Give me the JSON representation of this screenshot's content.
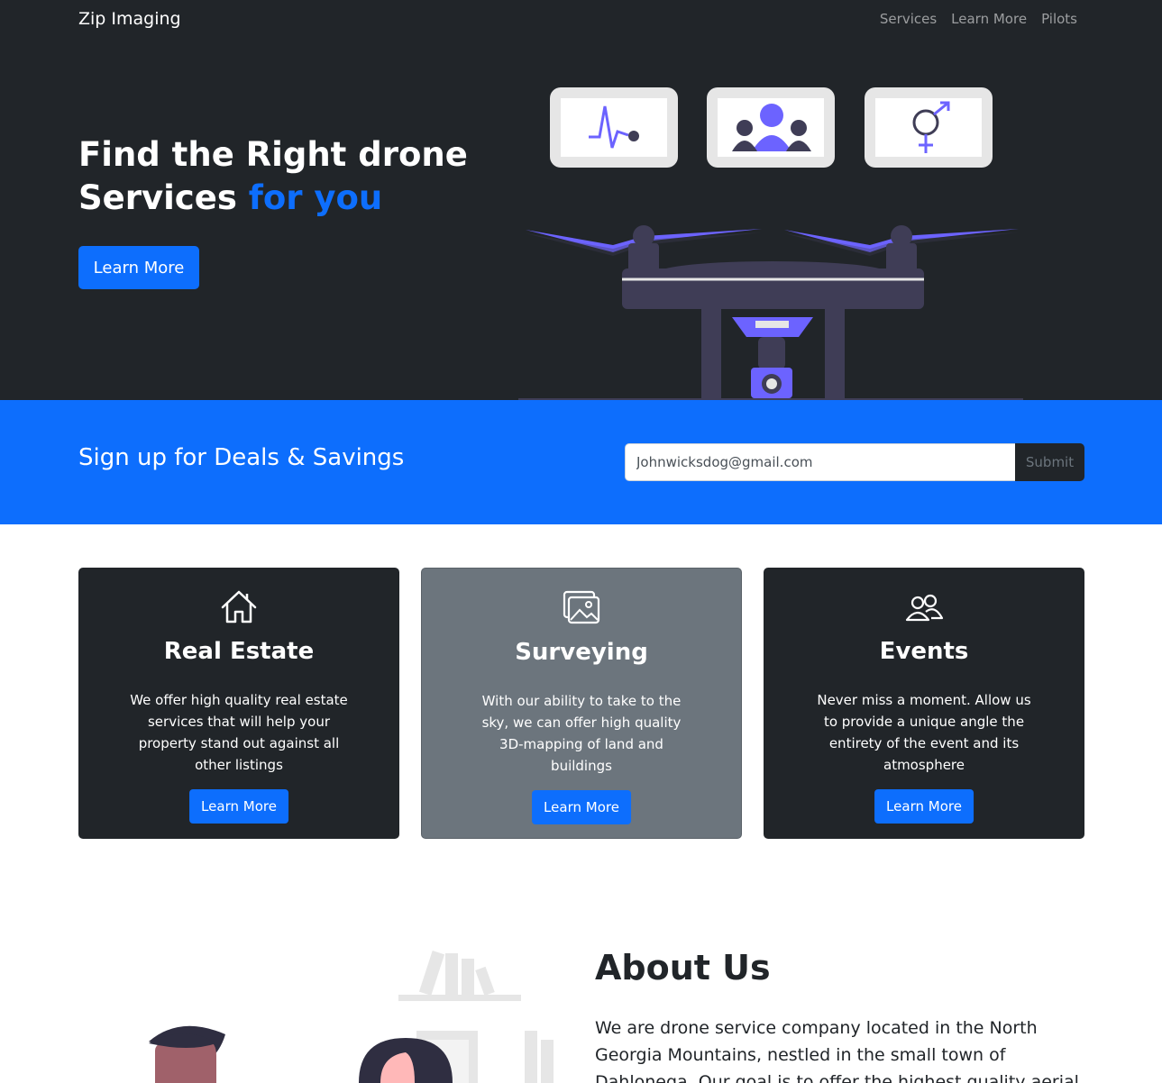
{
  "brand": "Zip Imaging",
  "nav": [
    "Services",
    "Learn More",
    "Pilots"
  ],
  "hero": {
    "title_line1": "Find the Right drone",
    "title_line2_start": "Services ",
    "title_line2_accent": "for you",
    "button": "Learn More"
  },
  "signup": {
    "title": "Sign up for Deals & Savings",
    "input_value": "Johnwicksdog@gmail.com",
    "submit": "Submit"
  },
  "cards": [
    {
      "title": "Real Estate",
      "text": "We offer high quality real estate services that will help your property stand out against all other listings",
      "button": "Learn More",
      "icon": "house-icon"
    },
    {
      "title": "Surveying",
      "text": "With our ability to take to the sky, we can offer high quality 3D-mapping of land and buildings",
      "button": "Learn More",
      "icon": "images-icon"
    },
    {
      "title": "Events",
      "text": "Never miss a moment. Allow us to provide a unique angle the entirety of the event and its atmosphere",
      "button": "Learn More",
      "icon": "people-icon"
    }
  ],
  "about": {
    "title": "About Us",
    "text": "We are drone service company located in the North Georgia Mountains, nestled in the small town of Dahlonega. Our goal is to offer the highest quality aerial photo and video"
  },
  "colors": {
    "primary": "#0d6efd",
    "dark": "#212529",
    "gray": "#6c757d",
    "purple": "#6c63ff",
    "drone": "#3f3d56"
  }
}
